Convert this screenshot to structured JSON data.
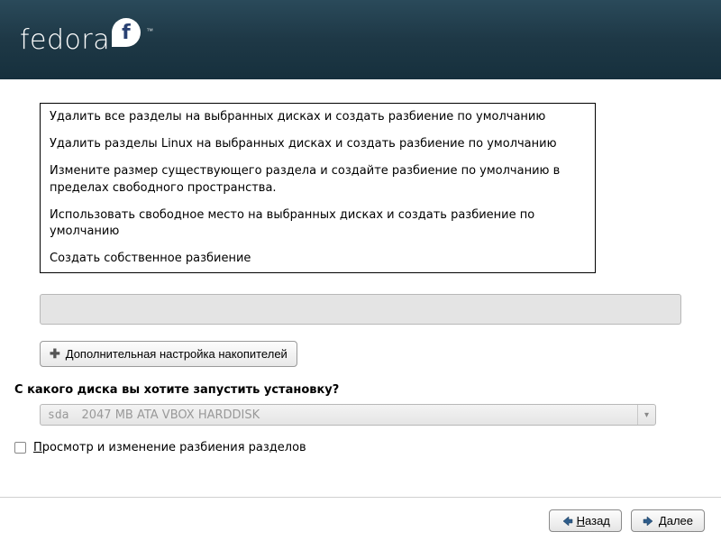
{
  "brand": "fedora",
  "partition_options": [
    "Удалить все разделы на выбранных дисках и создать разбиение по умолчанию",
    "Удалить разделы Linux на выбранных дисках и создать разбиение по умолчанию",
    "Измените размер существующего раздела и создайте разбиение по умолчанию в пределах свободного пространства.",
    "Использовать свободное место на выбранных дисках и создать разбиение по умолчанию",
    "Создать собственное разбиение"
  ],
  "advanced_button": {
    "label_first": "Д",
    "label_rest": "ополнительная настройка накопителей"
  },
  "boot_prompt": "С какого диска вы хотите запустить установку?",
  "disk": {
    "device": "sda",
    "description": "2047 MB ATA VBOX HARDDISK"
  },
  "review_checkbox": {
    "label_first": "П",
    "label_rest": "росмотр и изменение разбиения разделов",
    "checked": false
  },
  "nav": {
    "back_first": "Н",
    "back_rest": "азад",
    "next_first": "Д",
    "next_rest": "алее"
  }
}
